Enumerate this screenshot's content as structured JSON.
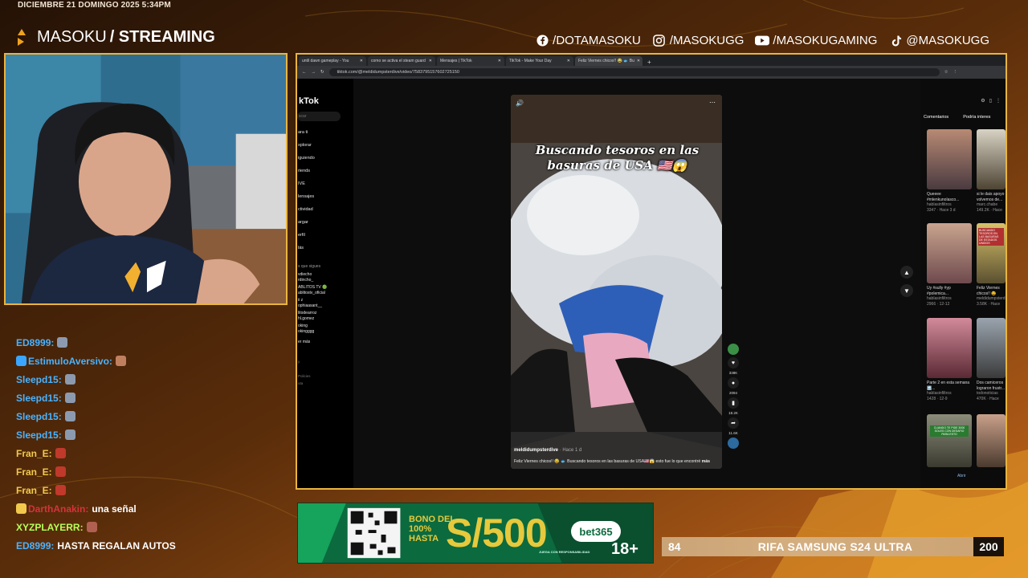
{
  "overlay": {
    "datetime": "DICIEMBRE 21 DOMINGO 2025 5:34PM",
    "brand_name": "MASOKU",
    "brand_sub": "/ STREAMING",
    "accent": "#e9b440",
    "socials": [
      {
        "icon": "facebook-icon",
        "label": "/DOTAMASOKU"
      },
      {
        "icon": "instagram-icon",
        "label": "/MASOKUGG"
      },
      {
        "icon": "youtube-icon",
        "label": "/MASOKUGAMING"
      },
      {
        "icon": "tiktok-icon",
        "label": "@MASOKUGG"
      }
    ]
  },
  "browser": {
    "tabs": [
      {
        "label": "until dawn gameplay - You",
        "active": false
      },
      {
        "label": "como se activa el steam guard",
        "active": false
      },
      {
        "label": "Mensajes | TikTok",
        "active": false
      },
      {
        "label": "TikTok - Make Your Day",
        "active": false
      },
      {
        "label": "Feliz Viernes chicos!! 😂 🐟 Bu",
        "active": true
      }
    ],
    "url": "tiktok.com/@meldidumpsterdive/video/7583795157602725150"
  },
  "tiktok": {
    "logo": "kTok",
    "search_placeholder": "scar",
    "nav": [
      "ara ti",
      "xplorar",
      "iguiendo",
      "riends",
      "IVE",
      "lensajes",
      "ctividad",
      "argar",
      "erfil",
      "lás"
    ],
    "following_header": "s que sigues",
    "following": [
      "vdiecho",
      "rdincho_",
      "ABLITOS TV 🟢",
      "ablitostv_oficial",
      "ii z",
      "ophiaasant__",
      "litodearroz",
      "hl.gomez",
      "oking",
      "okingggg",
      "er más"
    ],
    "footer": [
      "y",
      "Policies",
      "uta"
    ],
    "video": {
      "caption": "Buscando tesoros en las basuras de USA 🇺🇸😱",
      "author": "meldidumpsterdive",
      "time": "· Hace 1 d",
      "description": "Feliz Viernes chicos!! 😂 🐟 Buscando tesoros en las basuras de USA🇺🇸😱 esto fue lo que encontré",
      "more": "más",
      "likes": "338K",
      "comments": "2094",
      "saves": "18.2K",
      "shares": "11.6K"
    },
    "right_tabs": [
      "Comentarios",
      "Podría interes"
    ],
    "suggested": [
      {
        "title": "Queeee #mlenkunolasco...",
        "author": "hablasinfiltros",
        "meta": "3347 · Hace 3 d"
      },
      {
        "title": "si le dais apoyo volvemos de...",
        "author": "marc.chabe",
        "meta": "149.2K · Hace"
      },
      {
        "title": "Uy #sully #yp #polemica...",
        "author": "hablasinfiltros",
        "meta": "2966 · 12-12"
      },
      {
        "title": "Feliz Viernes chicos!! 😂",
        "author": "meldidumpsterd",
        "meta": "3.58K · Hace"
      },
      {
        "title": "Parte 2 en esta semana 🔜...",
        "author": "hablasinfiltros",
        "meta": "1428 · 12-9"
      },
      {
        "title": "Dos camiceros lograron frustr...",
        "author": "todonoticias",
        "meta": "470K · Hace"
      }
    ],
    "thumb_texts": [
      "BUSCANDO TESOROS EN LAS BASURAS DE ESTADOS UNIDOS",
      "CUANDO TE PIDE 3000 SOLES CON DESAFIO PARA ESTO"
    ],
    "bottom_right": "Abrir"
  },
  "chat": [
    {
      "user": "ED8999:",
      "text": "",
      "emote": "#8c9ab0",
      "user_color": "#4ab3ff"
    },
    {
      "user": "EstimuloAversivo:",
      "text": "",
      "emote": "#c08060",
      "user_color": "#4ab3ff",
      "badge": "#3aa6ff"
    },
    {
      "user": "Sleepd15:",
      "text": "",
      "emote": "#8c9ab0",
      "user_color": "#4ab3ff"
    },
    {
      "user": "Sleepd15:",
      "text": "",
      "emote": "#8c9ab0",
      "user_color": "#4ab3ff"
    },
    {
      "user": "Sleepd15:",
      "text": "",
      "emote": "#8c9ab0",
      "user_color": "#4ab3ff"
    },
    {
      "user": "Sleepd15:",
      "text": "",
      "emote": "#8c9ab0",
      "user_color": "#4ab3ff"
    },
    {
      "user": "Fran_E:",
      "text": "",
      "emote": "#c0392b",
      "user_color": "#f2c94c"
    },
    {
      "user": "Fran_E:",
      "text": "",
      "emote": "#c0392b",
      "user_color": "#f2c94c"
    },
    {
      "user": "Fran_E:",
      "text": "",
      "emote": "#c0392b",
      "user_color": "#f2c94c"
    },
    {
      "user": "DarthAnakin:",
      "text": "una señal",
      "emote": "",
      "user_color": "#d6323b",
      "badge": "#f2c94c"
    },
    {
      "user": "XYZPLAYERR:",
      "text": "",
      "emote": "#b06050",
      "user_color": "#b6ff5a"
    },
    {
      "user": "ED8999:",
      "text": "HASTA REGALAN AUTOS",
      "emote": "",
      "user_color": "#4ab3ff"
    }
  ],
  "ad": {
    "bono_line1": "BONO DEL",
    "bono_pct": "100%",
    "bono_line2": "HASTA",
    "amount": "S/500",
    "brand": "bet365",
    "age": "18+",
    "disclaimer": "JUEGA CON RESPONSABILIDAD"
  },
  "raffle": {
    "min": "84",
    "title": "RIFA SAMSUNG S24 ULTRA",
    "max": "200"
  }
}
